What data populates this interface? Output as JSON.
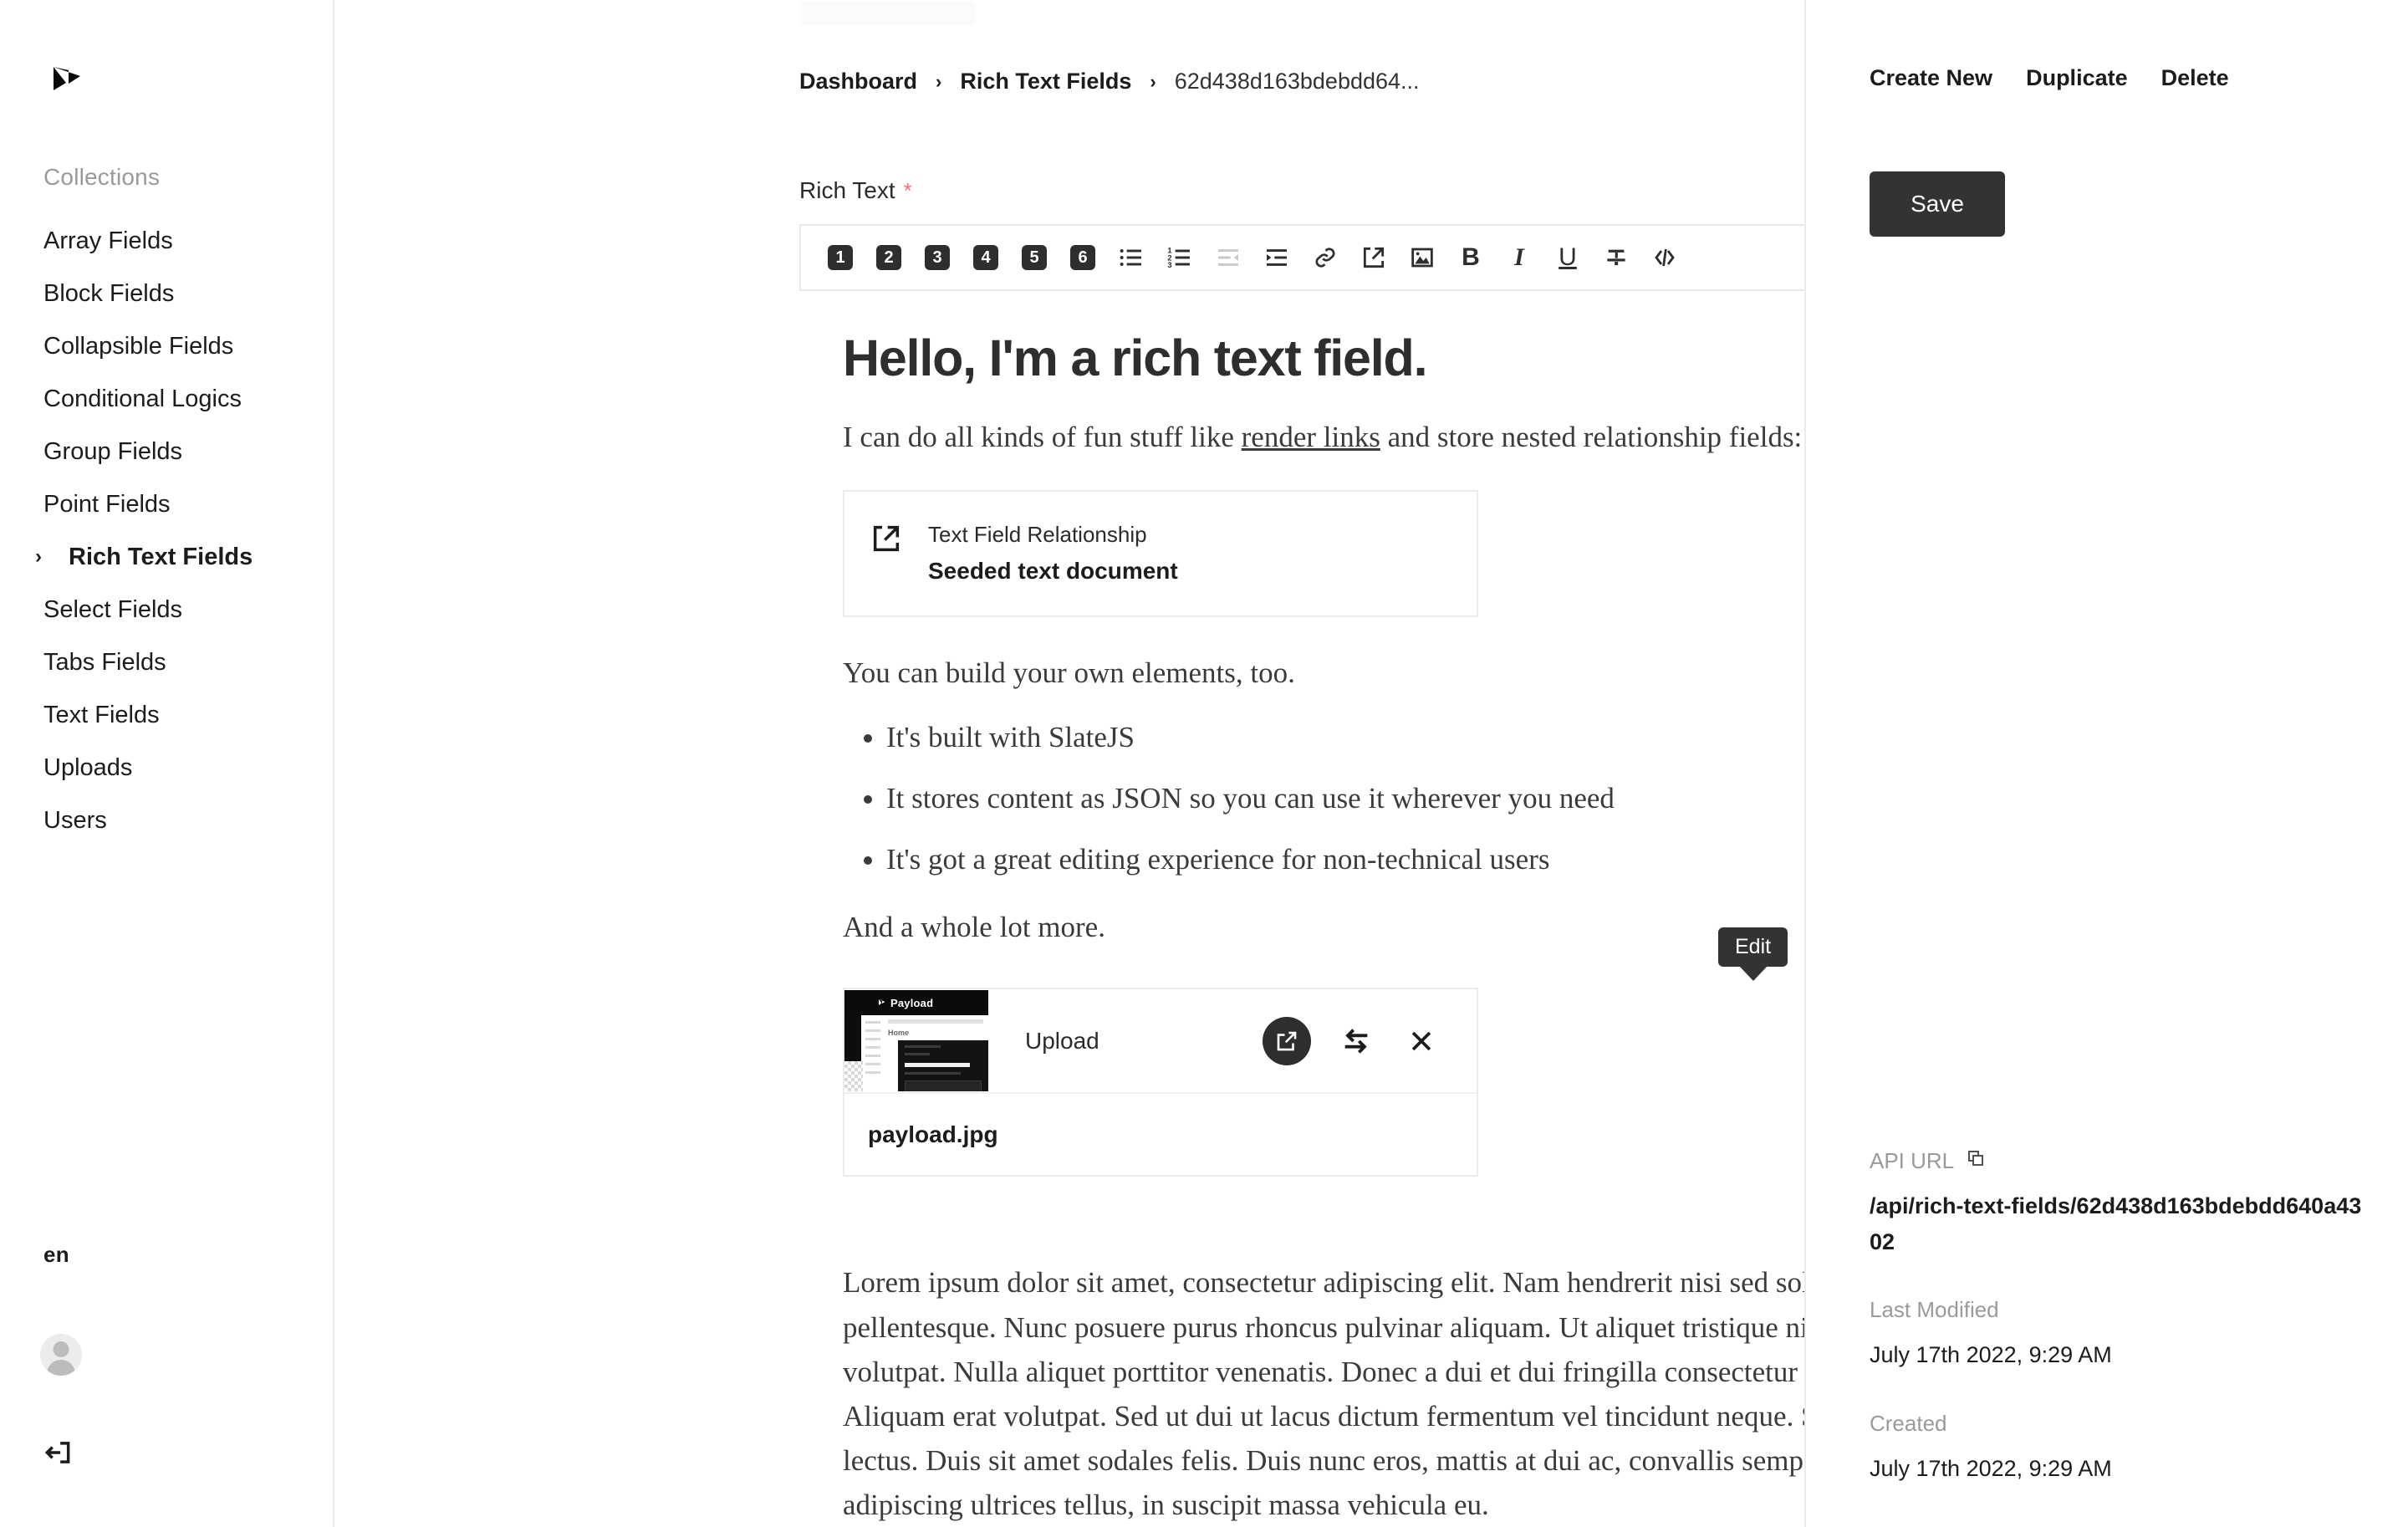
{
  "sidebar": {
    "logo_name": "payload-logo",
    "nav_heading": "Collections",
    "items": [
      {
        "label": "Array Fields",
        "active": false
      },
      {
        "label": "Block Fields",
        "active": false
      },
      {
        "label": "Collapsible Fields",
        "active": false
      },
      {
        "label": "Conditional Logics",
        "active": false
      },
      {
        "label": "Group Fields",
        "active": false
      },
      {
        "label": "Point Fields",
        "active": false
      },
      {
        "label": "Rich Text Fields",
        "active": true
      },
      {
        "label": "Select Fields",
        "active": false
      },
      {
        "label": "Tabs Fields",
        "active": false
      },
      {
        "label": "Text Fields",
        "active": false
      },
      {
        "label": "Uploads",
        "active": false
      },
      {
        "label": "Users",
        "active": false
      }
    ],
    "locale": "en",
    "avatar_name": "account-avatar",
    "logout_name": "logout-icon"
  },
  "breadcrumb": {
    "items": [
      "Dashboard",
      "Rich Text Fields",
      "62d438d163bdebdd64..."
    ],
    "separator": "›"
  },
  "field": {
    "label": "Rich Text",
    "required_marker": "*"
  },
  "toolbar": {
    "headings": [
      "1",
      "2",
      "3",
      "4",
      "5",
      "6"
    ],
    "buttons": [
      {
        "name": "heading-1-button",
        "label": "1"
      },
      {
        "name": "heading-2-button",
        "label": "2"
      },
      {
        "name": "heading-3-button",
        "label": "3"
      },
      {
        "name": "heading-4-button",
        "label": "4"
      },
      {
        "name": "heading-5-button",
        "label": "5"
      },
      {
        "name": "heading-6-button",
        "label": "6"
      },
      {
        "name": "bulleted-list-button",
        "label": "Bulleted List"
      },
      {
        "name": "numbered-list-button",
        "label": "Numbered List"
      },
      {
        "name": "outdent-button",
        "label": "Outdent"
      },
      {
        "name": "indent-button",
        "label": "Indent"
      },
      {
        "name": "link-button",
        "label": "Link"
      },
      {
        "name": "relationship-button",
        "label": "Relationship"
      },
      {
        "name": "upload-button",
        "label": "Upload"
      },
      {
        "name": "bold-button",
        "label": "B"
      },
      {
        "name": "italic-button",
        "label": "I"
      },
      {
        "name": "underline-button",
        "label": "U"
      },
      {
        "name": "strikethrough-button",
        "label": "Strikethrough"
      },
      {
        "name": "code-button",
        "label": "Code"
      }
    ]
  },
  "content": {
    "h1": "Hello, I'm a rich text field.",
    "p1_before": "I can do all kinds of fun stuff like ",
    "p1_link": "render links",
    "p1_after": " and store nested relationship fields:",
    "relationship": {
      "icon": "external-link-icon",
      "title": "Text Field Relationship",
      "document": "Seeded text document"
    },
    "p2": "You can build your own elements, too.",
    "list": [
      "It's built with SlateJS",
      "It stores content as JSON so you can use it wherever you need",
      "It's got a great editing experience for non-technical users"
    ],
    "p3": "And a whole lot more.",
    "upload": {
      "type_label": "Upload",
      "filename": "payload.jpg",
      "tooltip": "Edit",
      "thumbnail_brand": "Payload",
      "edit_icon": "edit-pencil-icon",
      "swap_icon": "swap-arrows-icon",
      "remove_icon": "close-x-icon"
    },
    "lorem": "Lorem ipsum dolor sit amet, consectetur adipiscing elit. Nam hendrerit nisi sed sollicitudin pellentesque. Nunc posuere purus rhoncus pulvinar aliquam. Ut aliquet tristique nisl vitae volutpat. Nulla aliquet porttitor venenatis. Donec a dui et dui fringilla consectetur id nec massa. Aliquam erat volutpat. Sed ut dui ut lacus dictum fermentum vel tincidunt neque. Sed sed lacinia lectus. Duis sit amet sodales felis. Duis nunc eros, mattis at dui ac, convallis semper risus. In adipiscing ultrices tellus, in suscipit massa vehicula eu."
  },
  "right_panel": {
    "actions": [
      "Create New",
      "Duplicate",
      "Delete"
    ],
    "save_label": "Save",
    "api_url_label": "API URL",
    "api_url_value": "/api/rich-text-fields/62d438d163bdebdd640a4302",
    "last_modified_label": "Last Modified",
    "last_modified_value": "July 17th 2022, 9:29 AM",
    "created_label": "Created",
    "created_value": "July 17th 2022, 9:29 AM",
    "copy_icon": "copy-icon"
  },
  "colors": {
    "accent_dark": "#333333",
    "required_red": "#ff6f76",
    "border": "#ececec",
    "muted_text": "#9a9a9a"
  }
}
